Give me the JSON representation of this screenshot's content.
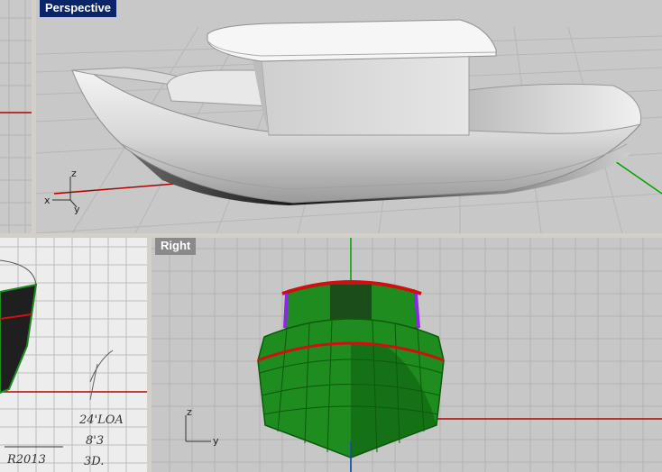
{
  "viewports": {
    "perspective": {
      "title": "Perspective",
      "active": true
    },
    "right": {
      "title": "Right",
      "active": false
    },
    "top_left": {
      "title": ""
    },
    "bottom_left": {
      "title": ""
    }
  },
  "axes": {
    "x": "x",
    "y": "y",
    "z": "z"
  },
  "sketch_notes": {
    "line1": "24'LOA",
    "line2": "8'3",
    "line3": "R2013",
    "line4": "3D."
  },
  "colors": {
    "viewport_bg": "#c9c9c9",
    "grid_line": "#b2b2b2",
    "major_axis_red": "#b40000",
    "major_axis_green": "#00a000",
    "hull_mesh_green": "#1e8c1e",
    "sheer_red": "#d01010",
    "rail_purple": "#8a2be2",
    "active_title": "#0a246a",
    "inactive_title": "#8a8a8a"
  }
}
